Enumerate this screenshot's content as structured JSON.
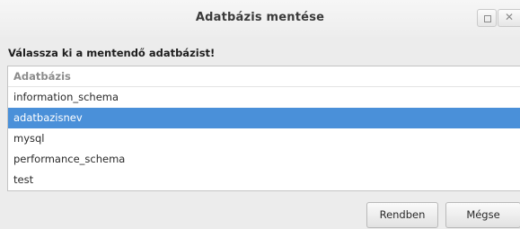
{
  "window": {
    "title": "Adatbázis mentése"
  },
  "instruction": "Válassza ki a mentendő adatbázist!",
  "list": {
    "column_header": "Adatbázis",
    "items": [
      "information_schema",
      "adatbazisnev",
      "mysql",
      "performance_schema",
      "test"
    ],
    "selected": "adatbazisnev"
  },
  "buttons": {
    "ok": "Rendben",
    "cancel": "Mégse"
  },
  "colors": {
    "selection": "#4a90d9",
    "window_bg": "#ececec"
  },
  "icons": {
    "maximize": "maximize-icon",
    "close": "close-icon"
  }
}
